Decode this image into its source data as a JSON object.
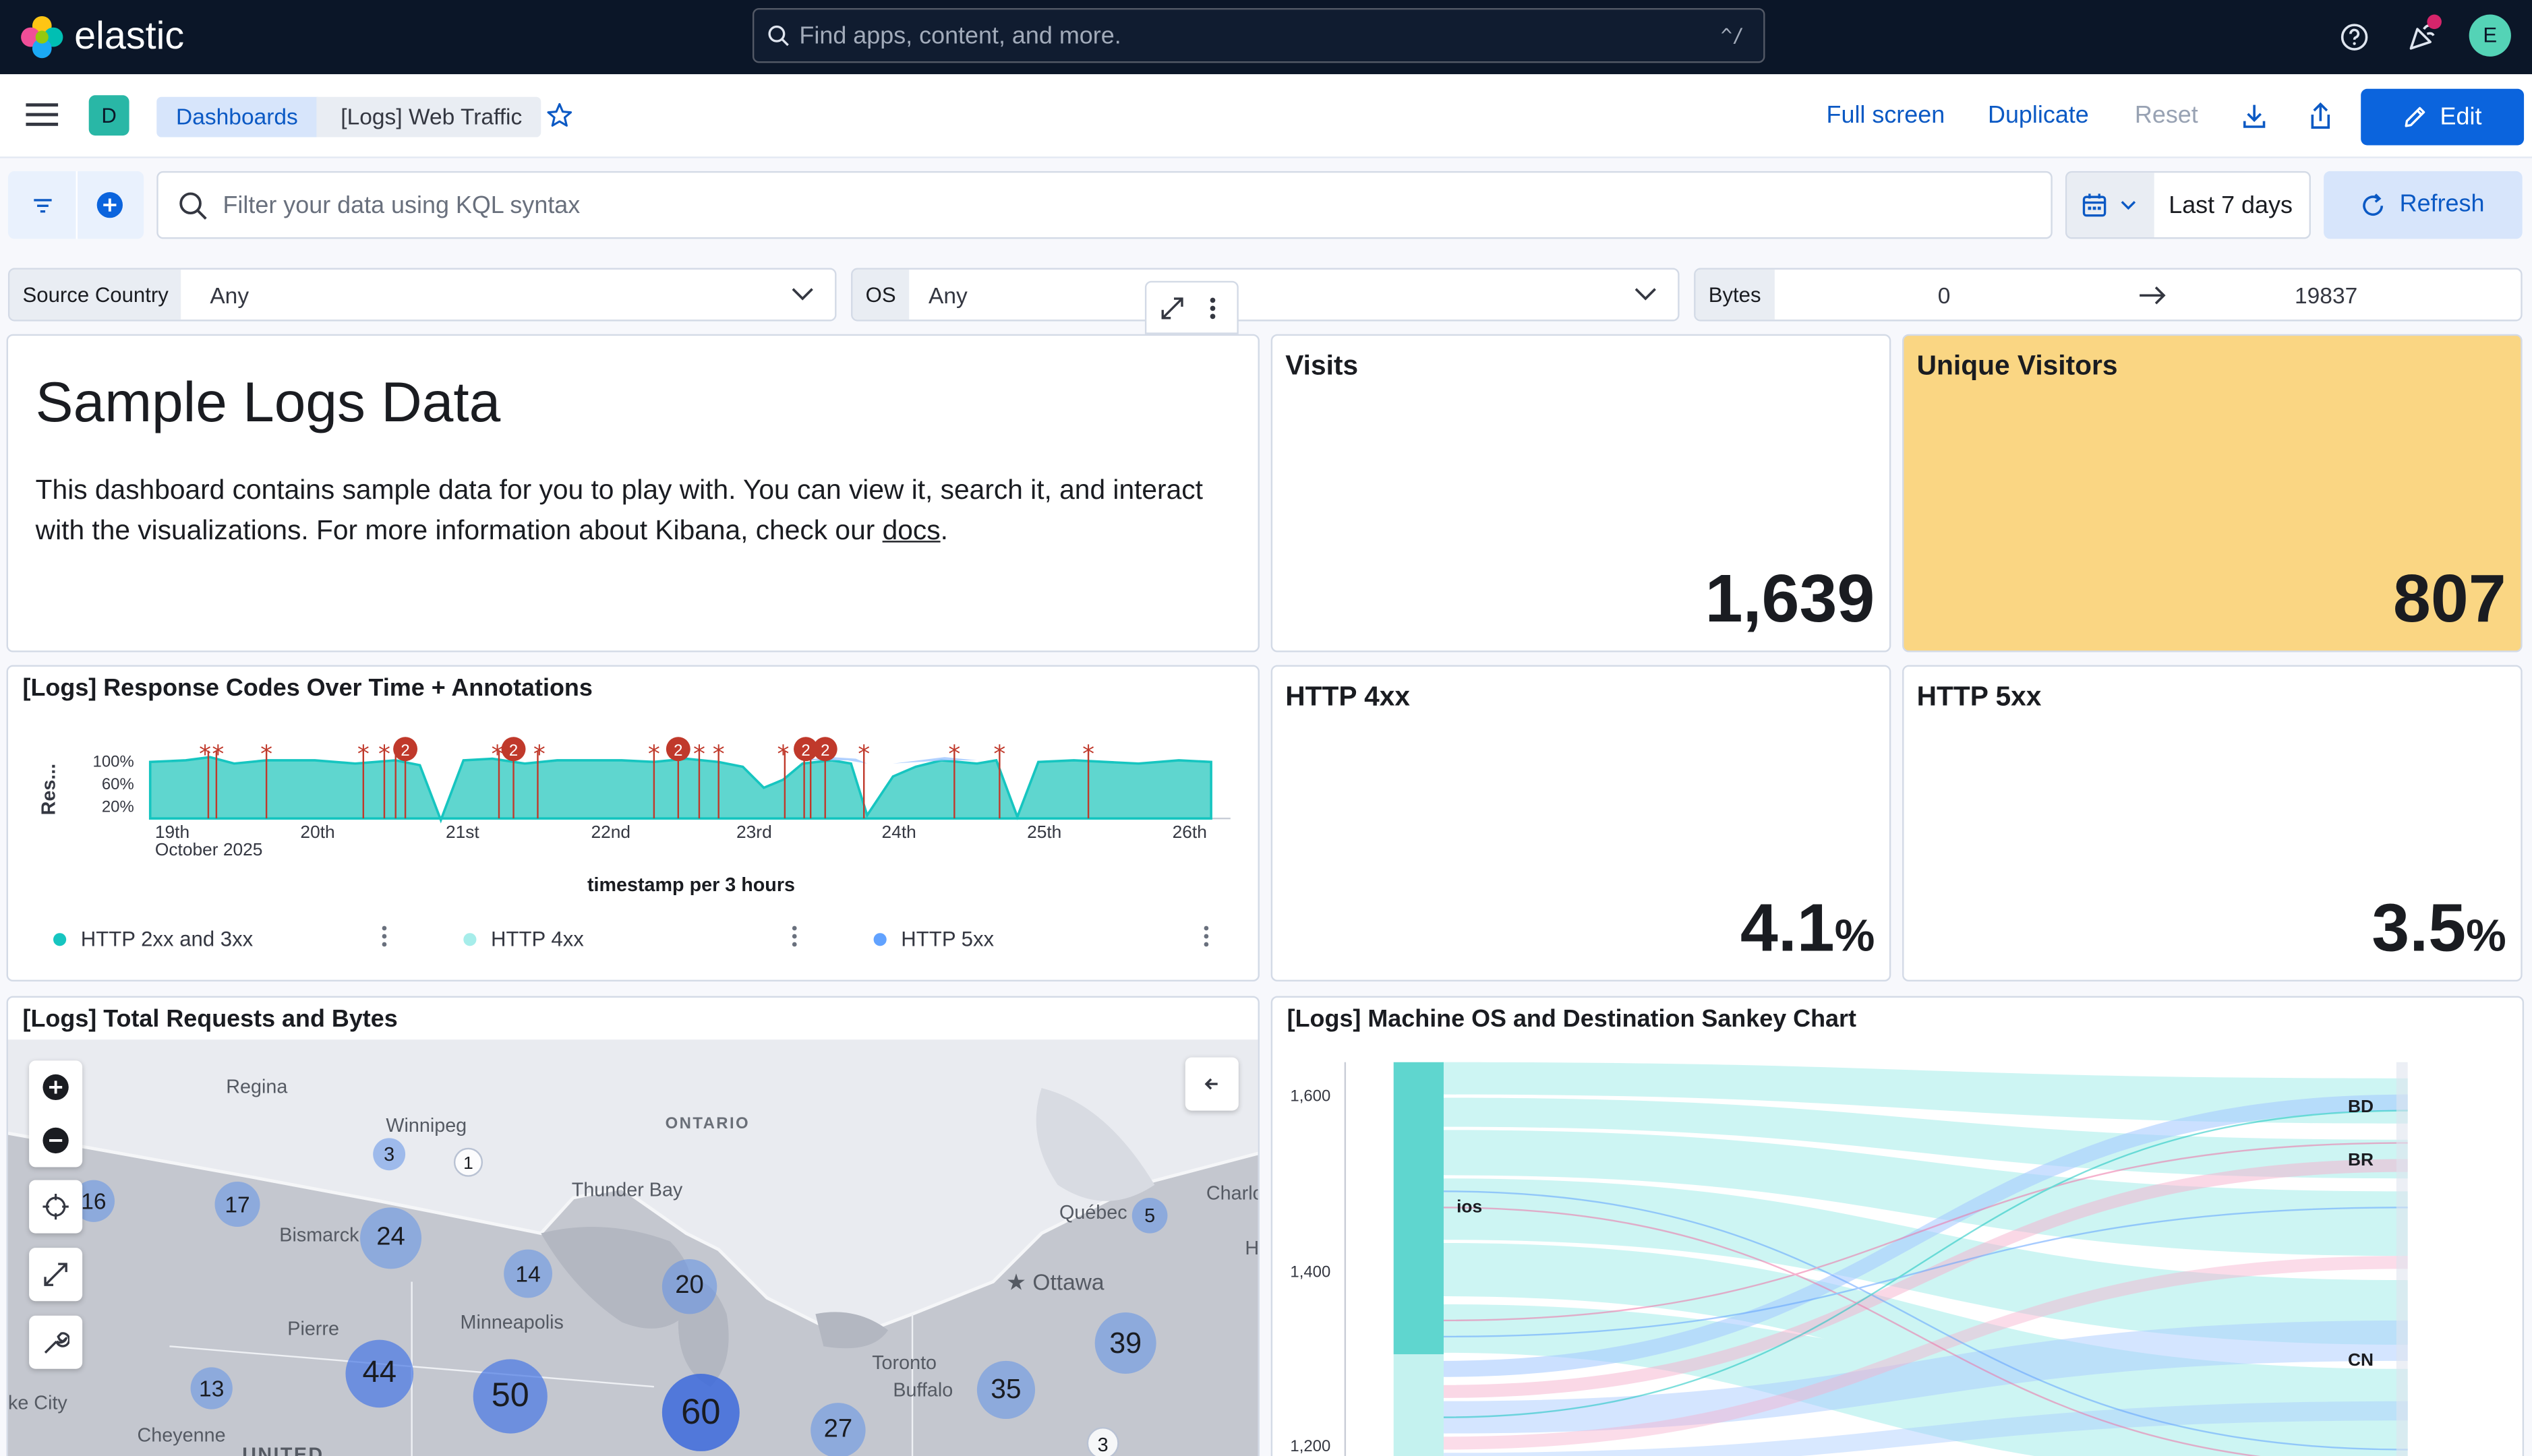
{
  "header": {
    "brand": "elastic",
    "search_placeholder": "Find apps, content, and more.",
    "search_shortcut": "^/",
    "avatar_initial": "E"
  },
  "nav": {
    "space_initial": "D",
    "breadcrumbs": [
      "Dashboards",
      "[Logs] Web Traffic"
    ],
    "actions": {
      "full_screen": "Full screen",
      "duplicate": "Duplicate",
      "reset": "Reset",
      "edit": "Edit"
    }
  },
  "query": {
    "placeholder": "Filter your data using KQL syntax",
    "time_range": "Last 7 days",
    "refresh": "Refresh"
  },
  "controls": {
    "source_country": {
      "label": "Source Country",
      "value": "Any"
    },
    "os": {
      "label": "OS",
      "value": "Any"
    },
    "bytes": {
      "label": "Bytes",
      "min": "0",
      "max": "19837"
    }
  },
  "markdown": {
    "title": "Sample Logs Data",
    "body_before_link": "This dashboard contains sample data for you to play with. You can view it, search it, and interact with the visualizations. For more information about Kibana, check our ",
    "link_text": "docs",
    "body_after_link": "."
  },
  "metrics": {
    "visits": {
      "label": "Visits",
      "value": "1,639"
    },
    "unique_visitors": {
      "label": "Unique Visitors",
      "value": "807",
      "bg_color": "#fad683"
    },
    "http4xx": {
      "label": "HTTP 4xx",
      "value": "4.1",
      "unit": "%"
    },
    "http5xx": {
      "label": "HTTP 5xx",
      "value": "3.5",
      "unit": "%"
    }
  },
  "response_chart": {
    "title": "[Logs] Response Codes Over Time + Annotations",
    "ylabel": "Res...",
    "xlabel": "timestamp per 3 hours",
    "y_ticks": [
      "100%",
      "60%",
      "20%"
    ],
    "x_ticks": [
      "19th",
      "20th",
      "21st",
      "22nd",
      "23rd",
      "24th",
      "25th",
      "26th"
    ],
    "x_sub": "October 2025",
    "annotation_badge": "2",
    "legend": [
      {
        "name": "HTTP 2xx and 3xx",
        "color": "#16c5c0"
      },
      {
        "name": "HTTP 4xx",
        "color": "#a6edea"
      },
      {
        "name": "HTTP 5xx",
        "color": "#61a2ff"
      }
    ]
  },
  "map_panel": {
    "title": "[Logs] Total Requests and Bytes",
    "places": [
      "Regina",
      "Winnipeg",
      "ONTARIO",
      "Thunder Bay",
      "Québec",
      "Charlo",
      "Bismarck",
      "Ottawa",
      "Minneapolis",
      "Pierre",
      "Toronto",
      "Buffalo",
      "Cheyenne",
      "ke City",
      "UNITED",
      "H"
    ],
    "clusters": [
      "3",
      "1",
      "16",
      "17",
      "24",
      "5",
      "14",
      "20",
      "39",
      "44",
      "50",
      "13",
      "60",
      "35",
      "27",
      "3"
    ]
  },
  "sankey": {
    "title": "[Logs] Machine OS and Destination Sankey Chart",
    "y_ticks": [
      "1,600",
      "1,400",
      "1,200"
    ],
    "node_labels": [
      "ios",
      "BD",
      "BR",
      "CN"
    ]
  }
}
